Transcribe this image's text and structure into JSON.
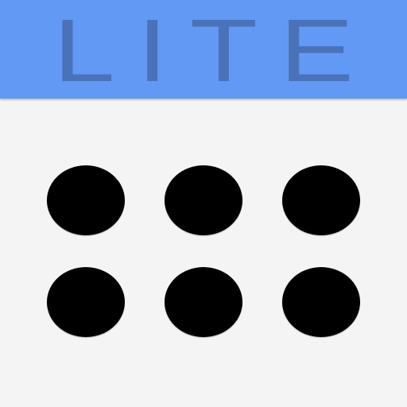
{
  "header": {
    "label": "LITE",
    "band_color": "#6199f5",
    "label_color": "#4a72b8"
  },
  "body": {
    "background_color": "#f4f4f4",
    "dot_color": "#000000",
    "dots": [
      {
        "name": "dot-row1-col1"
      },
      {
        "name": "dot-row1-col2"
      },
      {
        "name": "dot-row1-col3"
      },
      {
        "name": "dot-row2-col1"
      },
      {
        "name": "dot-row2-col2"
      },
      {
        "name": "dot-row2-col3"
      }
    ]
  }
}
